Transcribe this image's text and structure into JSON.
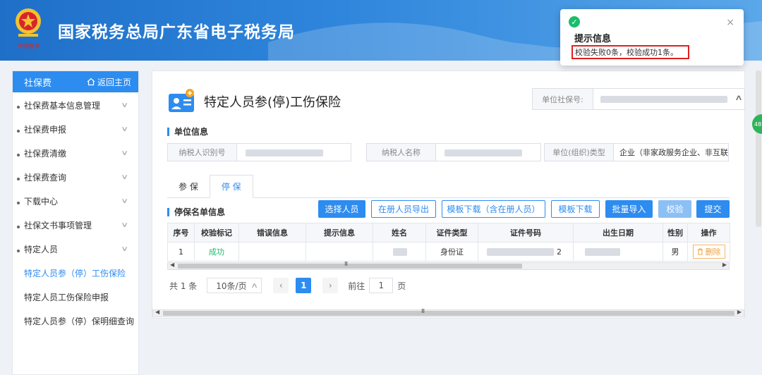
{
  "header": {
    "site_title": "国家税务总局广东省电子税务局",
    "emblem_text": "中国税务"
  },
  "sidebar": {
    "title": "社保费",
    "home_label": "返回主页",
    "items": [
      {
        "label": "社保费基本信息管理"
      },
      {
        "label": "社保费申报"
      },
      {
        "label": "社保费清缴"
      },
      {
        "label": "社保费查询"
      },
      {
        "label": "下载中心"
      },
      {
        "label": "社保文书事项管理"
      },
      {
        "label": "特定人员"
      }
    ],
    "subitems": [
      {
        "label": "特定人员参（停）工伤保险",
        "active": true
      },
      {
        "label": "特定人员工伤保险申报"
      },
      {
        "label": "特定人员参（停）保明细查询"
      }
    ]
  },
  "main": {
    "page_title": "特定人员参(停)工伤保险",
    "unit_social_no_label": "单位社保号:",
    "section_unit": "单位信息",
    "taxpayer_id_label": "纳税人识别号",
    "taxpayer_name_label": "纳税人名称",
    "org_type_label": "单位(组织)类型",
    "org_type_value": "企业（非家政服务企业、非互联网",
    "tabs": [
      {
        "label": "参 保"
      },
      {
        "label": "停 保",
        "active": true
      }
    ],
    "section_list": "停保名单信息",
    "buttons": {
      "select": "选择人员",
      "export": "在册人员导出",
      "tpl_with": "模板下载（含在册人员）",
      "tpl": "模板下载",
      "import": "批量导入",
      "verify": "校验",
      "submit": "提交"
    },
    "table": {
      "headers": [
        "序号",
        "校验标记",
        "错误信息",
        "提示信息",
        "姓名",
        "证件类型",
        "证件号码",
        "出生日期",
        "性别",
        "操作"
      ],
      "rows": [
        {
          "no": "1",
          "mark": "成功",
          "error": "",
          "hint": "",
          "name": "",
          "id_type": "身份证",
          "id_no_tail": "2",
          "birth": "",
          "gender": "男",
          "action": "删除"
        }
      ]
    },
    "pager": {
      "total": "共 1 条",
      "page_size": "10条/页",
      "current": "1",
      "goto_label": "前往",
      "goto_value": "1",
      "page_unit": "页"
    }
  },
  "toast": {
    "title": "提示信息",
    "message": "校验失败0条，校验成功1条。"
  },
  "side_badge": "48",
  "colors": {
    "primary": "#2d8cf0",
    "success": "#19be6b",
    "highlight": "#e02020",
    "header_blue": "#1f6fc8"
  }
}
